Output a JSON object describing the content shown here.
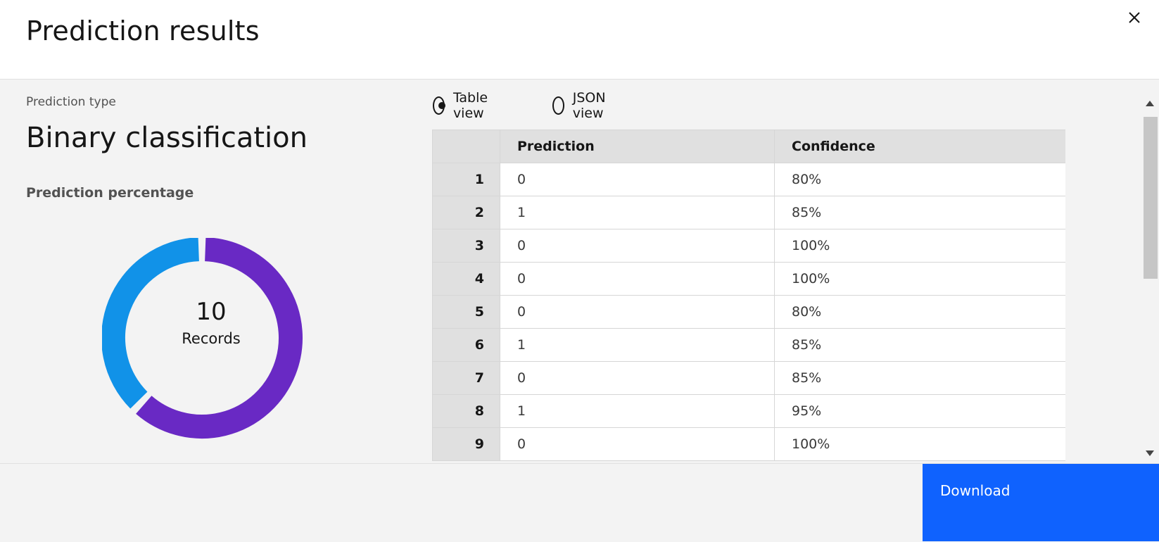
{
  "header": {
    "title": "Prediction results",
    "close_icon": "close-icon"
  },
  "summary": {
    "prediction_type_label": "Prediction type",
    "prediction_type_value": "Binary classification",
    "percentage_label": "Prediction percentage",
    "donut": {
      "count": "10",
      "count_label": "Records",
      "segments": [
        {
          "share": 0.62,
          "color": "#6929c4"
        },
        {
          "share": 0.38,
          "color": "#1192e8"
        }
      ]
    }
  },
  "view_toggle": {
    "options": [
      {
        "label": "Table view",
        "checked": true
      },
      {
        "label": "JSON view",
        "checked": false
      }
    ]
  },
  "table": {
    "columns": [
      "",
      "Prediction",
      "Confidence"
    ],
    "rows": [
      {
        "index": "1",
        "prediction": "0",
        "confidence": "80%"
      },
      {
        "index": "2",
        "prediction": "1",
        "confidence": "85%"
      },
      {
        "index": "3",
        "prediction": "0",
        "confidence": "100%"
      },
      {
        "index": "4",
        "prediction": "0",
        "confidence": "100%"
      },
      {
        "index": "5",
        "prediction": "0",
        "confidence": "80%"
      },
      {
        "index": "6",
        "prediction": "1",
        "confidence": "85%"
      },
      {
        "index": "7",
        "prediction": "0",
        "confidence": "85%"
      },
      {
        "index": "8",
        "prediction": "1",
        "confidence": "95%"
      },
      {
        "index": "9",
        "prediction": "0",
        "confidence": "100%"
      }
    ]
  },
  "footer": {
    "download_label": "Download"
  },
  "colors": {
    "primary": "#0f62fe",
    "purple": "#6929c4",
    "blue": "#1192e8"
  }
}
